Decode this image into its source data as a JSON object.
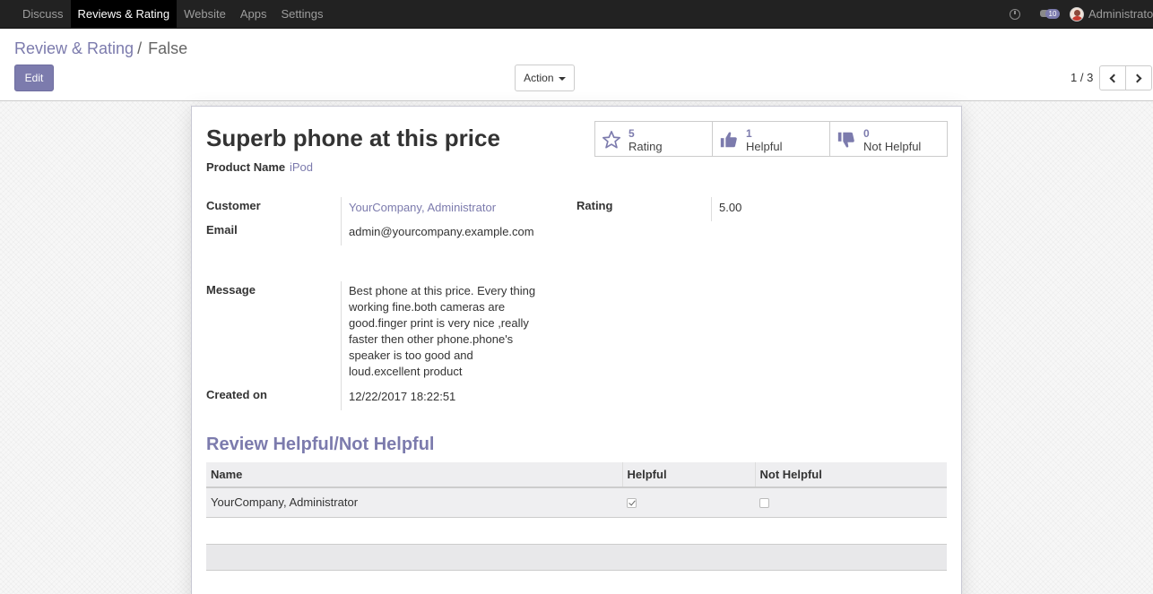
{
  "navbar": {
    "menu": [
      "Discuss",
      "Reviews & Rating",
      "Website",
      "Apps",
      "Settings"
    ],
    "active_index": 1,
    "message_count": "10",
    "user": "Administrator"
  },
  "control_panel": {
    "breadcrumb_parent": "Review & Rating",
    "breadcrumb_separator": "/",
    "breadcrumb_current": "False",
    "edit_label": "Edit",
    "action_label": "Action",
    "pager": "1 / 3"
  },
  "stats": [
    {
      "value": "5",
      "label": "Rating",
      "icon": "star-icon"
    },
    {
      "value": "1",
      "label": "Helpful",
      "icon": "thumbs-up-icon"
    },
    {
      "value": "0",
      "label": "Not Helpful",
      "icon": "thumbs-down-icon"
    }
  ],
  "record": {
    "title": "Superb phone at this price",
    "product_name_label": "Product Name",
    "product_name": "iPod",
    "customer_label": "Customer",
    "customer": "YourCompany, Administrator",
    "email_label": "Email",
    "email": "admin@yourcompany.example.com",
    "rating_label": "Rating",
    "rating": "5.00",
    "message_label": "Message",
    "message": "Best phone at this price. Every thing working fine.both cameras are good.finger print is very nice ,really faster then other phone.phone's speaker is too good and loud.excellent product",
    "created_label": "Created on",
    "created": "12/22/2017 18:22:51"
  },
  "helpful_section": {
    "title": "Review Helpful/Not Helpful",
    "columns": [
      "Name",
      "Helpful",
      "Not Helpful"
    ],
    "rows": [
      {
        "name": "YourCompany, Administrator",
        "helpful": true,
        "not_helpful": false
      }
    ]
  },
  "colors": {
    "accent": "#7c7bad",
    "navbar": "#222222"
  }
}
